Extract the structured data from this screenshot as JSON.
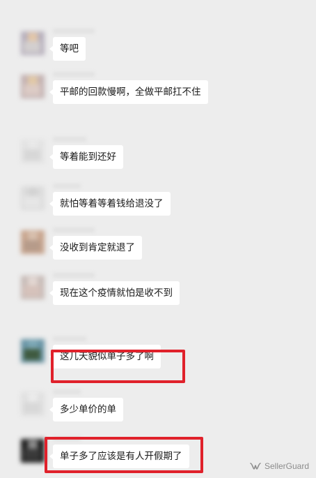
{
  "chat": {
    "messages": [
      {
        "text": "等吧",
        "avatar_colors": [
          "#b7b0bd",
          "#d3cfcf",
          "#e4c7a8"
        ]
      },
      {
        "text": "平邮的回款慢啊，全做平邮扛不住",
        "avatar_colors": [
          "#c4b3b3",
          "#dccbc5",
          "#e2c9a6"
        ]
      },
      {
        "text": "等着能到还好",
        "avatar_colors": [
          "#e3e3e3",
          "#d7d7d7",
          "#e9e9e9"
        ]
      },
      {
        "text": "就怕等着等着钱给退没了",
        "avatar_colors": [
          "#dcdcdc",
          "#e6e6e6",
          "#d2d2d2"
        ]
      },
      {
        "text": "没收到肯定就退了",
        "avatar_colors": [
          "#c8a58e",
          "#b69b8a",
          "#d8c0ae"
        ]
      },
      {
        "text": "现在这个疫情就怕是收不到",
        "avatar_colors": [
          "#c8bcb8",
          "#d6c2bb",
          "#e3d8d3"
        ]
      },
      {
        "text": "这几天貌似单子多了啊",
        "avatar_colors": [
          "#6a95a6",
          "#3f5a3f",
          "#7da8b6"
        ],
        "highlighted": true
      },
      {
        "text": "多少单价的单",
        "avatar_colors": [
          "#e0e0e0",
          "#d8d8d8",
          "#ececec"
        ]
      },
      {
        "text": "单子多了应该是有人开假期了",
        "avatar_colors": [
          "#1d1d1d",
          "#3a3a3a",
          "#8d8d8d"
        ],
        "highlighted": true
      }
    ]
  },
  "watermark": {
    "text": "SellerGuard",
    "icon": "wechat-channel-icon"
  },
  "colors": {
    "background": "#ededed",
    "bubble": "#ffffff",
    "highlight": "#e0212b",
    "text": "#191919"
  }
}
